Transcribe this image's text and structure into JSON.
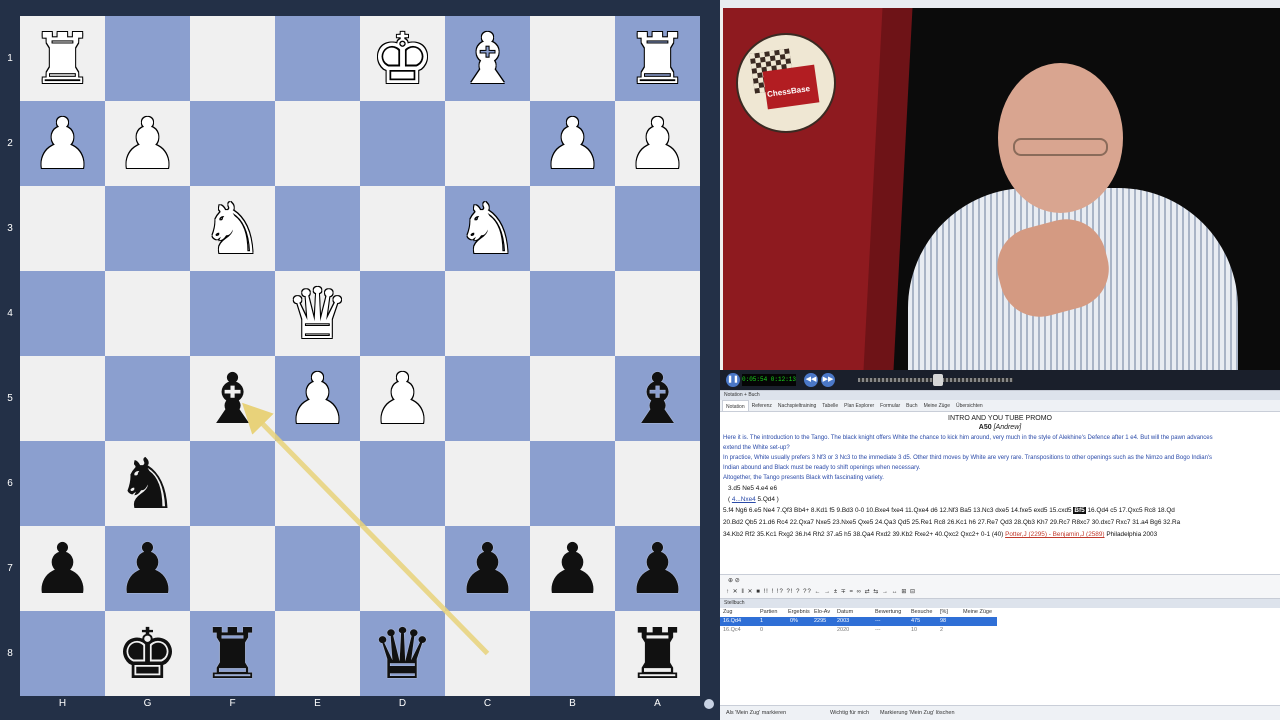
{
  "board": {
    "rank_labels": [
      "1",
      "2",
      "3",
      "4",
      "5",
      "6",
      "7",
      "8"
    ],
    "file_labels": [
      "H",
      "G",
      "F",
      "E",
      "D",
      "C",
      "B",
      "A"
    ],
    "pieces": [
      {
        "sq": "h1",
        "glyph": "♜",
        "side": "w",
        "name": "white-rook"
      },
      {
        "sq": "d1",
        "glyph": "♚",
        "side": "w",
        "name": "white-king"
      },
      {
        "sq": "c1",
        "glyph": "♝",
        "side": "w",
        "name": "white-bishop"
      },
      {
        "sq": "a1",
        "glyph": "♜",
        "side": "w",
        "name": "white-rook"
      },
      {
        "sq": "h2",
        "glyph": "♟",
        "side": "w",
        "name": "white-pawn"
      },
      {
        "sq": "g2",
        "glyph": "♟",
        "side": "w",
        "name": "white-pawn"
      },
      {
        "sq": "b2",
        "glyph": "♟",
        "side": "w",
        "name": "white-pawn"
      },
      {
        "sq": "a2",
        "glyph": "♟",
        "side": "w",
        "name": "white-pawn"
      },
      {
        "sq": "f3",
        "glyph": "♞",
        "side": "w",
        "name": "white-knight"
      },
      {
        "sq": "c3",
        "glyph": "♞",
        "side": "w",
        "name": "white-knight"
      },
      {
        "sq": "e4",
        "glyph": "♛",
        "side": "w",
        "name": "white-queen"
      },
      {
        "sq": "e5",
        "glyph": "♟",
        "side": "w",
        "name": "white-pawn"
      },
      {
        "sq": "d5",
        "glyph": "♟",
        "side": "w",
        "name": "white-pawn"
      },
      {
        "sq": "f5",
        "glyph": "♝",
        "side": "b",
        "name": "black-bishop"
      },
      {
        "sq": "a5",
        "glyph": "♝",
        "side": "b",
        "name": "black-bishop"
      },
      {
        "sq": "g6",
        "glyph": "♞",
        "side": "b",
        "name": "black-knight"
      },
      {
        "sq": "h7",
        "glyph": "♟",
        "side": "b",
        "name": "black-pawn"
      },
      {
        "sq": "g7",
        "glyph": "♟",
        "side": "b",
        "name": "black-pawn"
      },
      {
        "sq": "c7",
        "glyph": "♟",
        "side": "b",
        "name": "black-pawn"
      },
      {
        "sq": "b7",
        "glyph": "♟",
        "side": "b",
        "name": "black-pawn"
      },
      {
        "sq": "a7",
        "glyph": "♟",
        "side": "b",
        "name": "black-pawn"
      },
      {
        "sq": "g8",
        "glyph": "♚",
        "side": "b",
        "name": "black-king"
      },
      {
        "sq": "f8",
        "glyph": "♜",
        "side": "b",
        "name": "black-rook"
      },
      {
        "sq": "d8",
        "glyph": "♛",
        "side": "b",
        "name": "black-queen"
      },
      {
        "sq": "a8",
        "glyph": "♜",
        "side": "b",
        "name": "black-rook"
      }
    ],
    "arrow": {
      "from": "c8",
      "to": "f5",
      "color": "#e8d27a"
    },
    "colors": {
      "light": "#f0f0f0",
      "dark": "#8b9fcf"
    }
  },
  "video": {
    "window_title": "ChessBase",
    "logo_text": "ChessBase",
    "timecode": "0:05:54  0:12:13"
  },
  "notation": {
    "pane_caption": "Notation + Buch",
    "tabs": [
      "Notation",
      "Referenz",
      "Nachspieltraining",
      "Tabelle",
      "Plan Explorer",
      "Formular",
      "Buch",
      "Meine Züge",
      "Übersichten"
    ],
    "game_title": "INTRO AND YOU TUBE PROMO",
    "eco": "A50",
    "annotator": "[Andrew]",
    "paragraphs": [
      "Here it is. The introduction to the Tango. The black knight offers White the chance to kick him around, very much in the style of Alekhine's Defence after 1 e4. But will the pawn advances",
      "extend the White set-up?",
      "In practice, White usually prefers 3 Nf3 or 3 Nc3 to the immediate 3 d5. Other third moves by White are very rare. Transpositions to other openings such as the Nimzo and Bogo Indian's",
      "Indian abound and Black must be ready to shift openings when necessary.",
      "Altogether, the Tango presents Black with fascinating variety."
    ],
    "main_moves": "3.d5  Ne5  4.e4  e6",
    "variation_prefix": "( ",
    "variation_link": "4...Nxe4",
    "variation_suffix": "  5.Qd4 )",
    "line1_pre": "5.f4  Ng6  6.e5  Ne4  7.Qf3  Bb4+  8.Kd1  f5  9.Bd3  0-0  10.Bxe4  fxe4  11.Qxe4  d6  12.Nf3  Ba5  13.Nc3  dxe5  14.fxe5  exd5  15.cxd5 ",
    "line1_current": "Bf5",
    "line1_post": "  16.Qd4  c5  17.Qxc5  Rc8  18.Qd",
    "line2": "20.Bd2  Qb5  21.d6  Rc4  22.Qxa7  Nxe5  23.Nxe5  Qxe5  24.Qa3  Qd5  25.Re1  Rc8  26.Kc1  h6  27.Re7  Qd3  28.Qb3  Kh7  29.Rc7  R8xc7  30.dxc7  Rxc7  31.a4  Bg6  32.Ra",
    "line3_pre": "34.Kb2  Rf2  35.Kc1  Rxg2  36.h4  Rh2  37.a5  h5  38.Qa4  Rxd2  39.Kb2  Rxe2+  40.Qxc2  Qxc2+  0-1 (40)  ",
    "line3_players": "Potter,J (2295) - Benjamin,J (2589)",
    "line3_post": "  Philadelphia 2003"
  },
  "toolbar": {
    "row1": "⊕  ⊘",
    "row2": "↑  ✕  ‖  ✕  ■  !!  !  !?  ?!  ?  ??  ←  →  ±  ∓  =  ∞  ⇄  ⇆  →  ↔  ⊞  ⊟"
  },
  "book": {
    "caption": "Stellbuch",
    "headers": [
      "Zug",
      "Partien",
      "Ergebnis",
      "Elo-Av",
      "Datum",
      "Bewertung",
      "Besuche",
      "[%]",
      "Meine Züge"
    ],
    "rows": [
      [
        "16.Qd4",
        "1",
        "0%",
        "2295",
        "2003",
        "---",
        "475",
        "98",
        ""
      ],
      [
        "16.Qc4",
        "0",
        "",
        "",
        "2020",
        "---",
        "10",
        "2",
        ""
      ]
    ]
  },
  "status": {
    "items": [
      "Als 'Mein Zug' markieren",
      "Wichtig für mich",
      "Markierung 'Mein Zug' löschen"
    ]
  }
}
